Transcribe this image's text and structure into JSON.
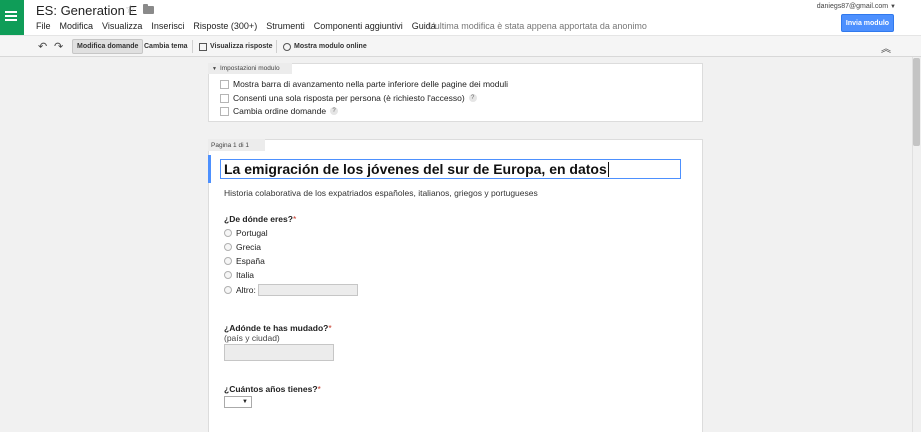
{
  "header": {
    "title": "ES: Generation E",
    "menu": [
      "File",
      "Modifica",
      "Visualizza",
      "Inserisci",
      "Risposte (300+)",
      "Strumenti",
      "Componenti aggiuntivi",
      "Guida"
    ],
    "last_edit": "L'ultima modifica è stata appena apportata da anonimo",
    "account": "daniegs87@gmail.com",
    "send_label": "Invia modulo"
  },
  "toolbar": {
    "edit_questions": "Modifica domande",
    "change_theme": "Cambia tema",
    "view_responses": "Visualizza risposte",
    "show_live_form": "Mostra modulo online"
  },
  "settings": {
    "tab_label": "Impostazioni modulo",
    "options": [
      {
        "label": "Mostra barra di avanzamento nella parte inferiore delle pagine dei moduli",
        "checked": false,
        "help": false
      },
      {
        "label": "Consenti una sola risposta per persona (è richiesto l'accesso)",
        "checked": false,
        "help": true
      },
      {
        "label": "Cambia ordine domande",
        "checked": false,
        "help": true
      }
    ],
    "help_glyph": "?"
  },
  "form": {
    "page_label": "Pagina 1 di 1",
    "title": "La emigración de los jóvenes del sur de Europa, en datos",
    "description": "Historia colaborativa de los expatriados españoles, italianos, griegos y portugueses",
    "required_mark": "*",
    "q1": {
      "title": "¿De dónde eres?",
      "options": [
        "Portugal",
        "Grecia",
        "España",
        "Italia"
      ],
      "other_label": "Altro:"
    },
    "q2": {
      "title": "¿Adónde te has mudado?",
      "help": "(país y ciudad)"
    },
    "q3": {
      "title": "¿Cuántos años tienes?",
      "select_arrow": "▼"
    }
  },
  "colors": {
    "brand_green": "#0f9d58",
    "accent_blue": "#4d90fe",
    "required_red": "#c53929"
  }
}
